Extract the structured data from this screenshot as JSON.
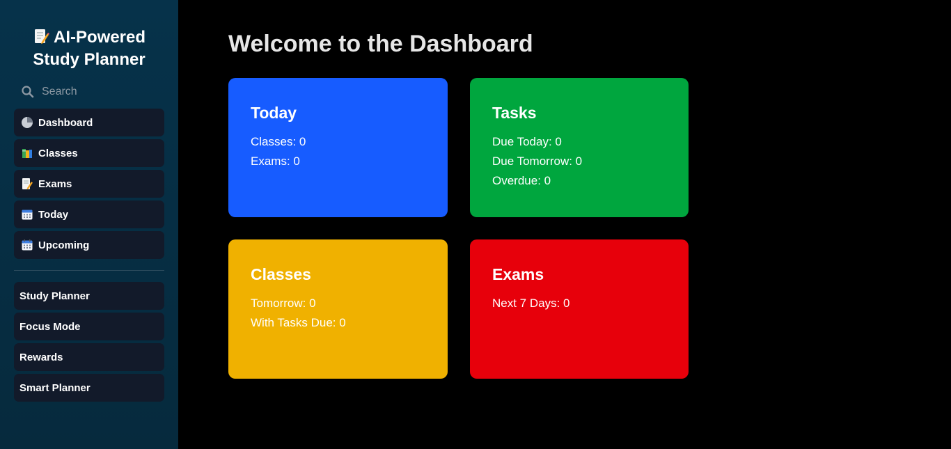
{
  "sidebar": {
    "title": "AI-Powered Study Planner",
    "title_icon": "memo-icon",
    "search_placeholder": "Search",
    "primary_items": [
      {
        "label": "Dashboard",
        "icon": "pie-chart-icon"
      },
      {
        "label": "Classes",
        "icon": "books-icon"
      },
      {
        "label": "Exams",
        "icon": "memo-icon"
      },
      {
        "label": "Today",
        "icon": "calendar-icon"
      },
      {
        "label": "Upcoming",
        "icon": "calendar-icon"
      }
    ],
    "secondary_items": [
      {
        "label": "Study Planner"
      },
      {
        "label": "Focus Mode"
      },
      {
        "label": "Rewards"
      },
      {
        "label": "Smart Planner"
      }
    ]
  },
  "main": {
    "title": "Welcome to the Dashboard",
    "cards": {
      "today": {
        "title": "Today",
        "color": "#175cff",
        "lines": [
          "Classes: 0",
          "Exams: 0"
        ]
      },
      "tasks": {
        "title": "Tasks",
        "color": "#00a63e",
        "lines": [
          "Due Today: 0",
          "Due Tomorrow: 0",
          "Overdue: 0"
        ]
      },
      "classes": {
        "title": "Classes",
        "color": "#f0b100",
        "lines": [
          "Tomorrow: 0",
          "With Tasks Due: 0"
        ]
      },
      "exams": {
        "title": "Exams",
        "color": "#e7000b",
        "lines": [
          "Next 7 Days: 0"
        ]
      }
    }
  }
}
